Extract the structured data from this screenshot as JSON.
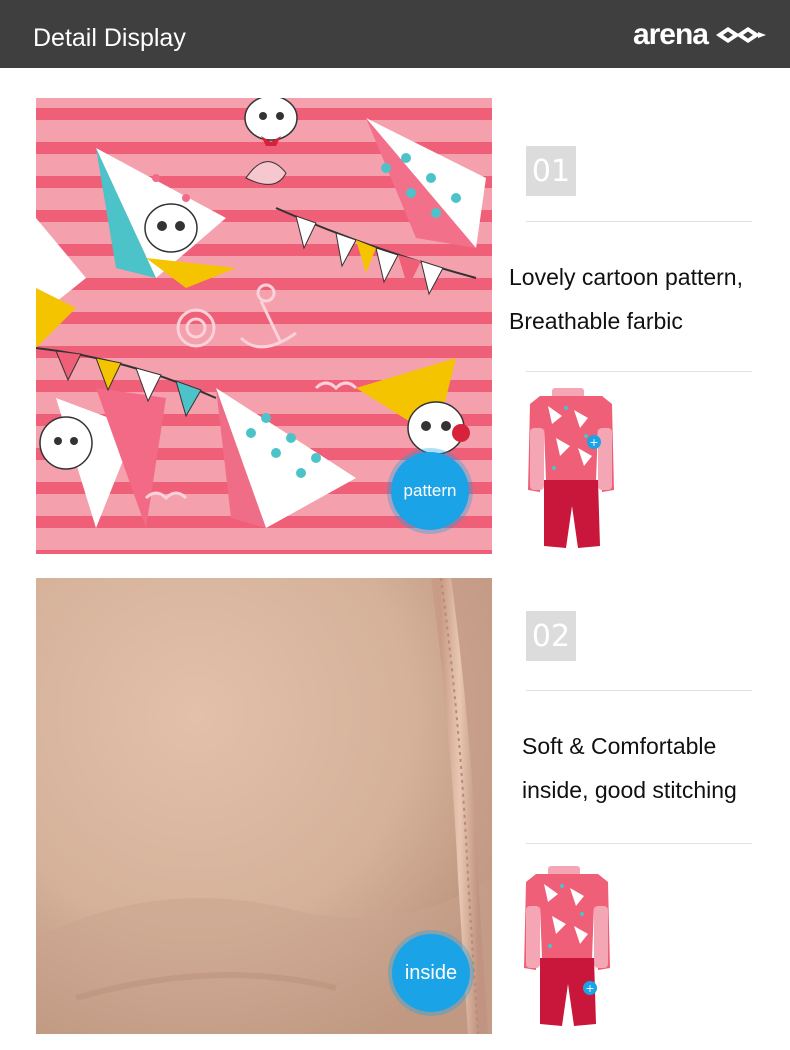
{
  "header": {
    "title": "Detail Display",
    "brand": "arena"
  },
  "details": [
    {
      "number": "01",
      "badge": "pattern",
      "line1": "Lovely cartoon pattern,",
      "line2": "Breathable farbic"
    },
    {
      "number": "02",
      "badge": "inside",
      "line1": "Soft & Comfortable",
      "line2": "inside, good stitching"
    }
  ],
  "colors": {
    "header_bg": "#3f3f3f",
    "badge_blue": "#1aa3e6",
    "pattern_pink": "#f0607a",
    "fabric_beige": "#d8b39c"
  }
}
